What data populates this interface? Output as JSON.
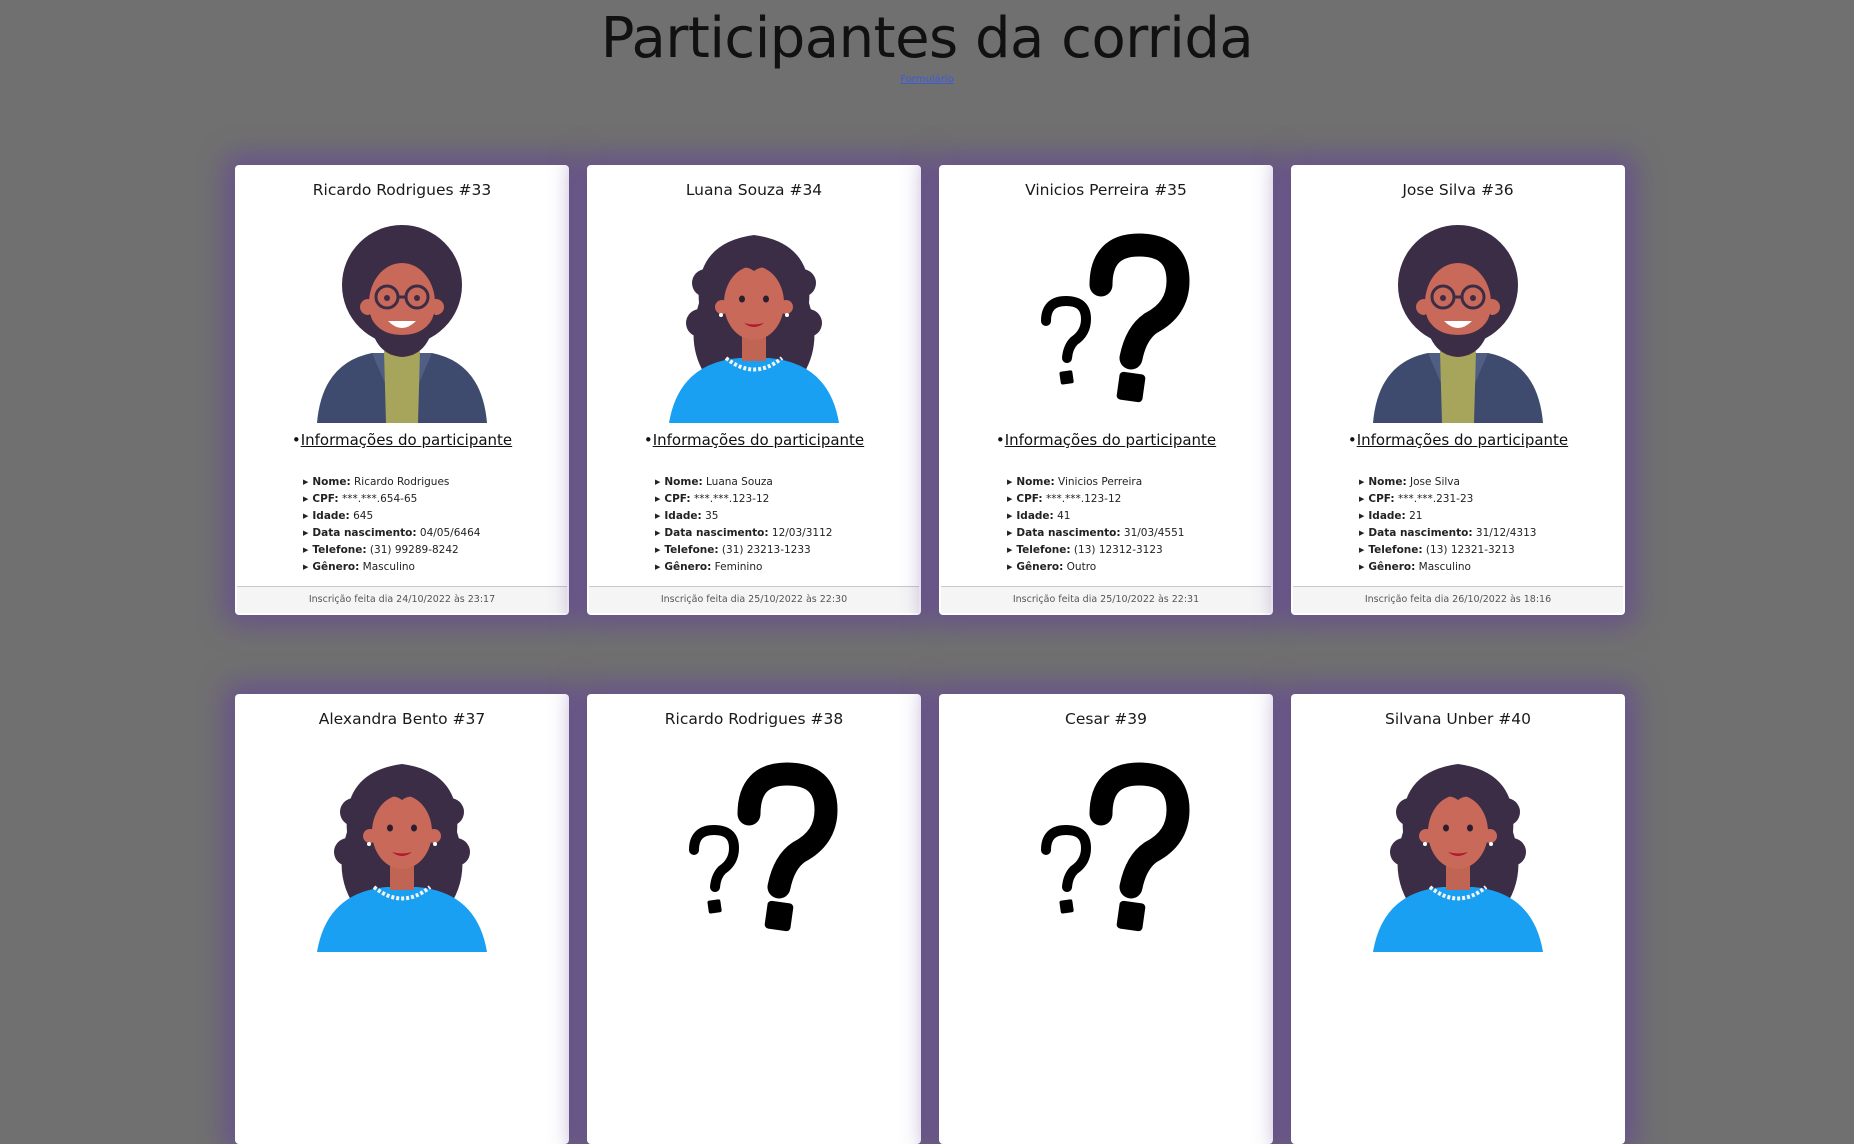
{
  "header": {
    "title": "Participantes da corrida",
    "form_link": "Formulário"
  },
  "info_heading": "Informações do participante",
  "labels": {
    "nome": "Nome:",
    "cpf": "CPF:",
    "idade": "Idade:",
    "nascimento": "Data nascimento:",
    "telefone": "Telefone:",
    "genero": "Gênero:"
  },
  "cards": [
    {
      "name": "Ricardo Rodrigues #33",
      "avatar": "male-avatar-icon",
      "nome": "Ricardo Rodrigues",
      "cpf": "***.***.654-65",
      "idade": "645",
      "nascimento": "04/05/6464",
      "telefone": "(31) 99289-8242",
      "genero": "Masculino",
      "footer": "Inscrição feita dia 24/10/2022 às 23:17"
    },
    {
      "name": "Luana Souza #34",
      "avatar": "female-avatar-icon",
      "nome": "Luana Souza",
      "cpf": "***.***.123-12",
      "idade": "35",
      "nascimento": "12/03/3112",
      "telefone": "(31) 23213-1233",
      "genero": "Feminino",
      "footer": "Inscrição feita dia 25/10/2022 às 22:30"
    },
    {
      "name": "Vinicios Perreira #35",
      "avatar": "question-mark-icon",
      "nome": "Vinicios Perreira",
      "cpf": "***.***.123-12",
      "idade": "41",
      "nascimento": "31/03/4551",
      "telefone": "(13) 12312-3123",
      "genero": "Outro",
      "footer": "Inscrição feita dia 25/10/2022 às 22:31"
    },
    {
      "name": "Jose Silva #36",
      "avatar": "male-avatar-icon",
      "nome": "Jose Silva",
      "cpf": "***.***.231-23",
      "idade": "21",
      "nascimento": "31/12/4313",
      "telefone": "(13) 12321-3213",
      "genero": "Masculino",
      "footer": "Inscrição feita dia 26/10/2022 às 18:16"
    },
    {
      "name": "Alexandra Bento #37",
      "avatar": "female-avatar-icon"
    },
    {
      "name": "Ricardo Rodrigues #38",
      "avatar": "question-mark-icon"
    },
    {
      "name": "Cesar #39",
      "avatar": "question-mark-icon"
    },
    {
      "name": "Silvana Unber #40",
      "avatar": "female-avatar-icon"
    }
  ],
  "colors": {
    "background": "#707070",
    "card_glow": "#6a4c93"
  }
}
